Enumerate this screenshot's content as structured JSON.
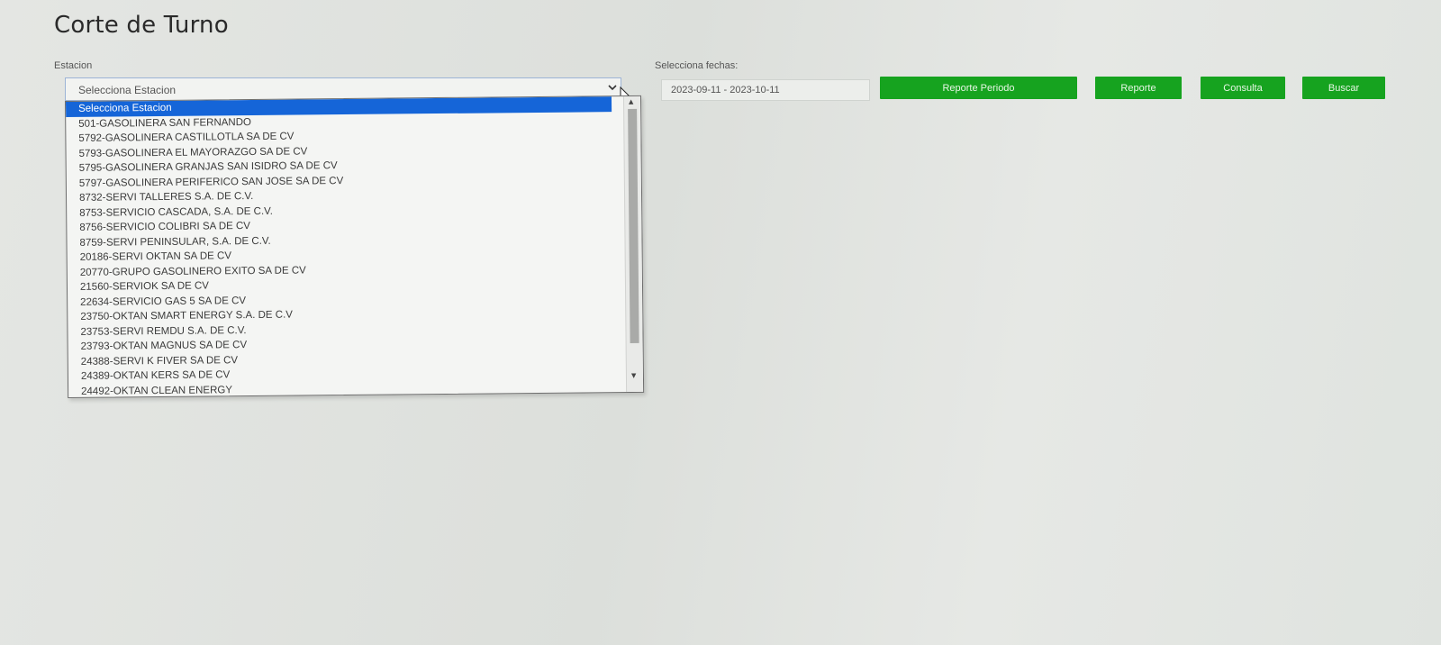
{
  "page": {
    "title": "Corte de Turno"
  },
  "station": {
    "label": "Estacion",
    "selected_value": "Selecciona Estacion",
    "options": [
      "Selecciona Estacion",
      "501-GASOLINERA SAN FERNANDO",
      "5792-GASOLINERA CASTILLOTLA SA DE CV",
      "5793-GASOLINERA EL MAYORAZGO SA DE CV",
      "5795-GASOLINERA GRANJAS SAN ISIDRO SA DE CV",
      "5797-GASOLINERA PERIFERICO SAN JOSE SA DE CV",
      "8732-SERVI TALLERES S.A. DE C.V.",
      "8753-SERVICIO CASCADA, S.A. DE C.V.",
      "8756-SERVICIO COLIBRI SA DE CV",
      "8759-SERVI PENINSULAR, S.A. DE C.V.",
      "20186-SERVI OKTAN SA DE CV",
      "20770-GRUPO GASOLINERO EXITO SA DE CV",
      "21560-SERVIOK SA DE CV",
      "22634-SERVICIO GAS 5 SA DE CV",
      "23750-OKTAN SMART ENERGY S.A. DE C.V",
      "23753-SERVI REMDU S.A. DE C.V.",
      "23793-OKTAN MAGNUS SA DE CV",
      "24388-SERVI K FIVER SA DE CV",
      "24389-OKTAN KERS SA DE CV",
      "24492-OKTAN CLEAN ENERGY"
    ],
    "highlighted_index": 0
  },
  "dates": {
    "label": "Selecciona fechas:",
    "value": "2023-09-11 - 2023-10-11"
  },
  "buttons": {
    "reporte_periodo": "Reporte Periodo",
    "reporte": "Reporte",
    "consulta": "Consulta",
    "buscar": "Buscar"
  },
  "icons": {
    "select_arrow": "chevron-down-icon",
    "mouse_pointer": "cursor-icon",
    "scroll_up": "scroll-up-icon",
    "scroll_down": "scroll-down-icon"
  },
  "colors": {
    "button_green": "#16a31f",
    "selection_blue": "#1565d8"
  }
}
